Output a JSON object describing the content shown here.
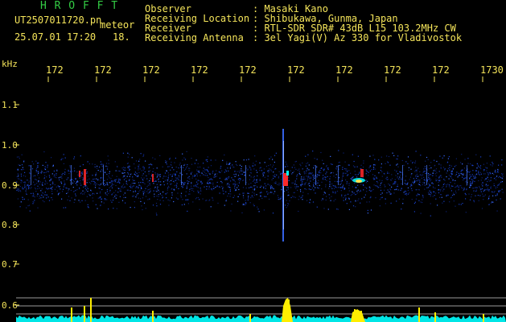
{
  "header": {
    "station_name": "H R O F F T",
    "filename": "UT2507011720.pn",
    "detection_label": "meteor",
    "date_time": "25.07.01 17:20",
    "count": "18.",
    "info_rows": [
      {
        "label": "Observer",
        "value": ": Masaki Kano"
      },
      {
        "label": "Receiving Location",
        "value": ": Shibukawa, Gunma, Japan"
      },
      {
        "label": "Receiver",
        "value": ": RTL-SDR SDR# 43dB L15 103.2MHz CW"
      },
      {
        "label": "Receiving Antenna",
        "value": ": 3el Yagi(V) Az 330 for Vladivostok"
      }
    ]
  },
  "axis": {
    "unit_label": "kHz",
    "freq_ticks": [
      "172",
      "172",
      "172",
      "172",
      "172",
      "172",
      "172",
      "172",
      "172",
      "1730"
    ],
    "y_ticks": [
      "1.1",
      "1.0",
      "0.9",
      "0.8",
      "0.7",
      "0.6"
    ]
  },
  "colors": {
    "text_green": "#33cc44",
    "text_yellow": "#f4e45a",
    "signal_red": "#ff2a2a",
    "signal_cyan": "#00ffff",
    "noise_blue": "#1840c8",
    "trace_yellow": "#ffee00",
    "ref_line": "#9a9a9a"
  }
}
